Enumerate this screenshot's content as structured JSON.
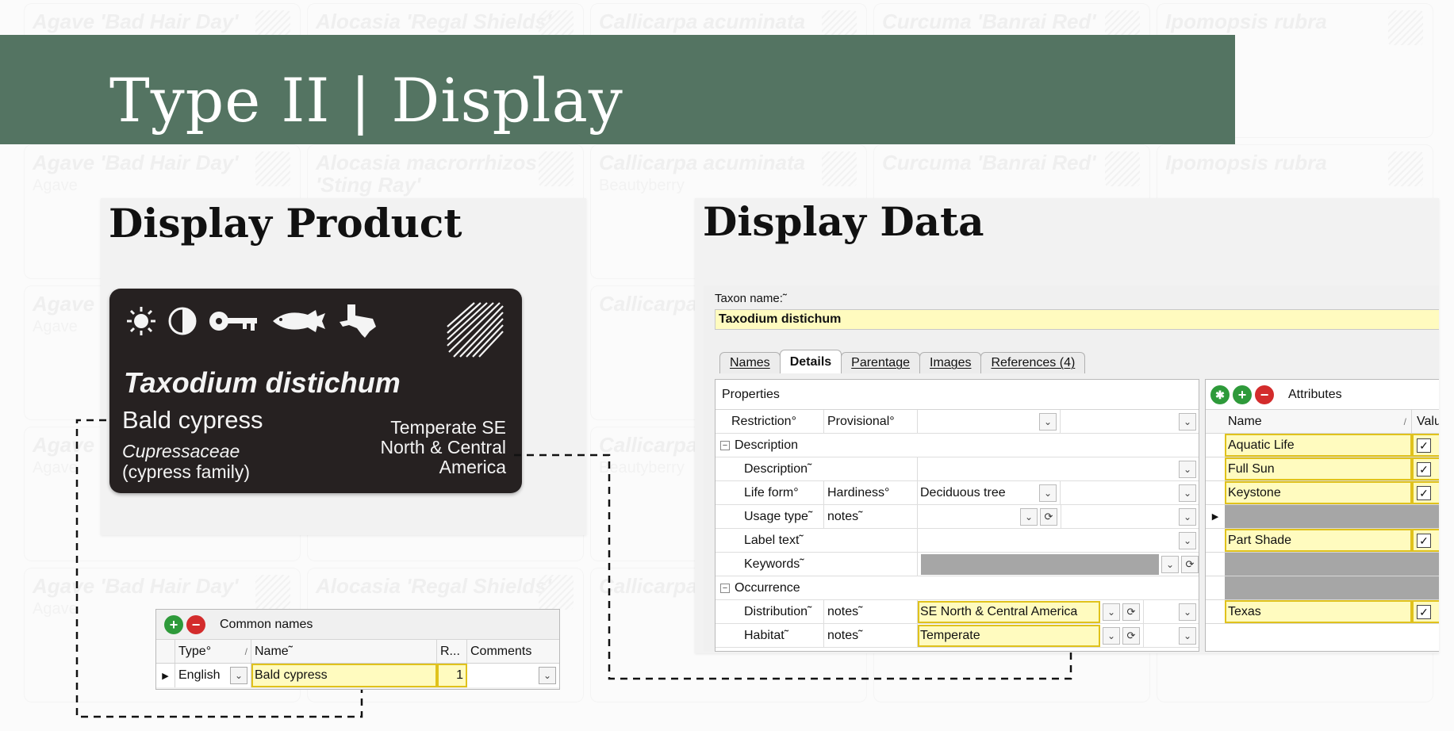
{
  "slide": {
    "title": "Type II | Display",
    "left_title": "Display Product",
    "right_title": "Display Data"
  },
  "colors": {
    "banner": "#547462",
    "highlight_fill": "#fffbbf",
    "highlight_border": "#e0c21c",
    "label_bg": "#262121"
  },
  "background_labels": [
    {
      "title": "Agave 'Bad Hair Day'",
      "sub": "Agave"
    },
    {
      "title": "Alocasia 'Regal Shields'",
      "sub": ""
    },
    {
      "title": "Callicarpa acuminata",
      "sub": ""
    },
    {
      "title": "Curcuma 'Banrai Red'",
      "sub": ""
    },
    {
      "title": "Ipomopsis rubra",
      "sub": ""
    },
    {
      "title": "Agave 'Bad Hair Day'",
      "sub": "Agave"
    },
    {
      "title": "Alocasia macrorrhizos 'Sting Ray'",
      "sub": ""
    },
    {
      "title": "Callicarpa acuminata",
      "sub": "Beautyberry"
    },
    {
      "title": "Curcuma 'Banrai Red'",
      "sub": ""
    },
    {
      "title": "Ipomopsis rubra",
      "sub": ""
    }
  ],
  "label_card": {
    "icons": [
      "sun-icon",
      "part-shade-icon",
      "keystone-icon",
      "fish-icon",
      "texas-icon"
    ],
    "scientific_name": "Taxodium distichum",
    "common_name": "Bald cypress",
    "family": "Cupressaceae",
    "family_common": "(cypress family)",
    "region_line1": "Temperate SE",
    "region_line2": "North & Central",
    "region_line3": "America"
  },
  "common_names": {
    "title": "Common names",
    "columns": [
      "Type°",
      "Name˜",
      "R...",
      "Comments"
    ],
    "row": {
      "type": "English",
      "name": "Bald cypress",
      "rank": "1",
      "comments": ""
    }
  },
  "data_window": {
    "taxon_label": "Taxon name:˜",
    "taxon_value": "Taxodium distichum",
    "tabs": [
      "Names",
      "Details",
      "Parentage",
      "Images",
      "References (4)"
    ],
    "active_tab": "Details",
    "properties": {
      "title": "Properties",
      "restriction": {
        "label": "Restriction°",
        "sub": "Provisional°",
        "value": ""
      },
      "description_section": "Description",
      "description": {
        "label": "Description˜",
        "value": ""
      },
      "life_form": {
        "label": "Life form°",
        "sub": "Hardiness°",
        "value": "Deciduous tree"
      },
      "usage_type": {
        "label": "Usage type˜",
        "sub": "notes˜",
        "value": ""
      },
      "label_text": {
        "label": "Label text˜",
        "value": ""
      },
      "keywords": {
        "label": "Keywords˜",
        "value": ""
      },
      "occurrence_section": "Occurrence",
      "distribution": {
        "label": "Distribution˜",
        "sub": "notes˜",
        "value": "SE North & Central America"
      },
      "habitat": {
        "label": "Habitat˜",
        "sub": "notes˜",
        "value": "Temperate"
      }
    },
    "attributes": {
      "title": "Attributes",
      "col_name": "Name",
      "col_value": "Valu",
      "rows": [
        {
          "name": "Aquatic Life",
          "checked": true,
          "highlight": true
        },
        {
          "name": "Full Sun",
          "checked": true,
          "highlight": true
        },
        {
          "name": "Keystone",
          "checked": true,
          "highlight": true
        },
        {
          "name": "",
          "checked": false,
          "highlight": false
        },
        {
          "name": "Part Shade",
          "checked": true,
          "highlight": true
        },
        {
          "name": "",
          "checked": false,
          "highlight": false
        },
        {
          "name": "",
          "checked": false,
          "highlight": false
        },
        {
          "name": "Texas",
          "checked": true,
          "highlight": true
        }
      ]
    }
  }
}
